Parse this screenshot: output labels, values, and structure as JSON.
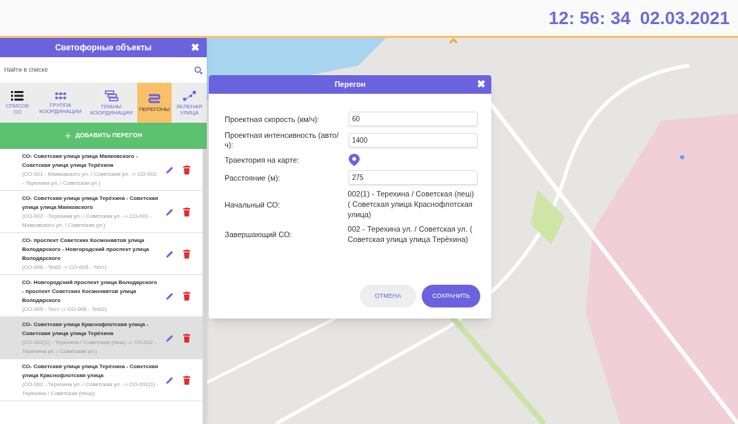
{
  "clock": {
    "time": "12: 56: 34",
    "date": "02.03.2021"
  },
  "panel": {
    "title": "Светофорные объекты",
    "close": "✖",
    "search": {
      "placeholder": "Найти в списке"
    },
    "tabs": [
      {
        "label": "СПИСОК СО",
        "kind": "list",
        "selected": false
      },
      {
        "label": "ГРУППА КООРДИНАЦИИ",
        "kind": "group",
        "selected": false
      },
      {
        "label": "ПЛАНЫ КООРДИНАЦИИ",
        "kind": "plans",
        "selected": false
      },
      {
        "label": "ПЕРЕГОНЫ",
        "kind": "segments",
        "selected": true
      },
      {
        "label": "ЗЕЛЕНАЯ УЛИЦА",
        "kind": "route",
        "selected": false
      }
    ],
    "add_button": {
      "icon": "+",
      "label": "ДОБАВИТЬ ПЕРЕГОН"
    },
    "items": [
      {
        "title": "СО- Советская улица улица Маяковского - Советская улица улица Терёхина",
        "detail": "(СО-001 - Маяковского ул. / Советская ул. -> СО-002 - Терехина ул. / Советская ул.)",
        "selected": false
      },
      {
        "title": "СО- Советская улица улица Терёхина - Советская улица улица Маяковского",
        "detail": "(СО-002 - Терехина ул. / Советская ул. -> СО-001 - Маяковского ул. / Советская ул.)",
        "selected": false
      },
      {
        "title": "СО- проспект Советских Космонавтов улица Володарского - Новгородский проспект улица Володарского",
        "detail": "(СО-006 - Test2 -> СО-005 - Тест)",
        "selected": false
      },
      {
        "title": "СО- Новгородский проспект улица Володарского - проспект Советских Космонавтов улица Володарского",
        "detail": "(СО-005 - Тест -> СО-006 - Test2)",
        "selected": false
      },
      {
        "title": "СО- Советская улица Краснофлотская улица - Советская улица улица Терёхина",
        "detail": "(СО-002(1) - Терехина / Советская (пеш) -> СО-002 - Терехина ул. / Советская ул.)",
        "selected": true
      },
      {
        "title": "СО- Советская улица улица Терёхина - Советская улица Краснофлотская улица",
        "detail": "(СО-002 - Терехина ул. / Советская ул. -> СО-002(1) - Терехина / Советская (пеш))",
        "selected": false
      }
    ]
  },
  "dialog": {
    "title": "Перегон",
    "close": "✖",
    "rows": [
      {
        "kind": "input",
        "label": "Проектная скорость (км/ч):",
        "value": "60"
      },
      {
        "kind": "input",
        "label": "Проектная интенсивность (авто/ч):",
        "value": "1400"
      },
      {
        "kind": "pin",
        "label": "Траектория на карте:"
      },
      {
        "kind": "input",
        "label": "Расстояние (м):",
        "value": "275"
      },
      {
        "kind": "text",
        "label": "Начальный СО:",
        "value": "002(1) - Терехина / Советская (пеш) ( Советская улица Краснофлотская улица)"
      },
      {
        "kind": "text",
        "label": "Завершающий СО:",
        "value": "002 - Терехина ул. / Советская ул. ( Советская улица улица Терёхина)"
      }
    ],
    "cancel": "ОТМЕНА",
    "save": "СОХРАНИТЬ"
  }
}
